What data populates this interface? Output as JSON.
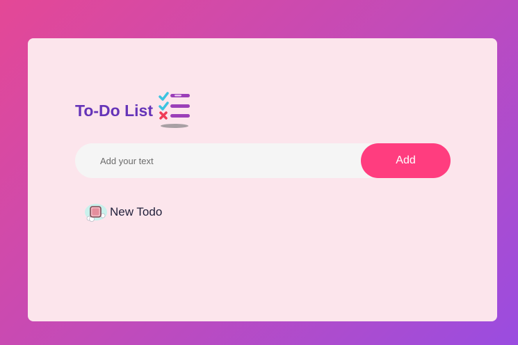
{
  "app": {
    "title": "To-Do List",
    "title_icon": "checklist-icon"
  },
  "input": {
    "placeholder": "Add your text",
    "value": ""
  },
  "add_button": {
    "label": "Add"
  },
  "todos": [
    {
      "text": "New Todo",
      "checked": false,
      "icon": "unchecked-checkbox-icon"
    }
  ],
  "colors": {
    "background_start": "#e44896",
    "background_end": "#9a4ce0",
    "card": "#fce5ec",
    "title": "#6534b8",
    "add_button": "#ff3d7f",
    "input_bg": "#f5f5f5",
    "todo_text": "#1f1f3a"
  }
}
